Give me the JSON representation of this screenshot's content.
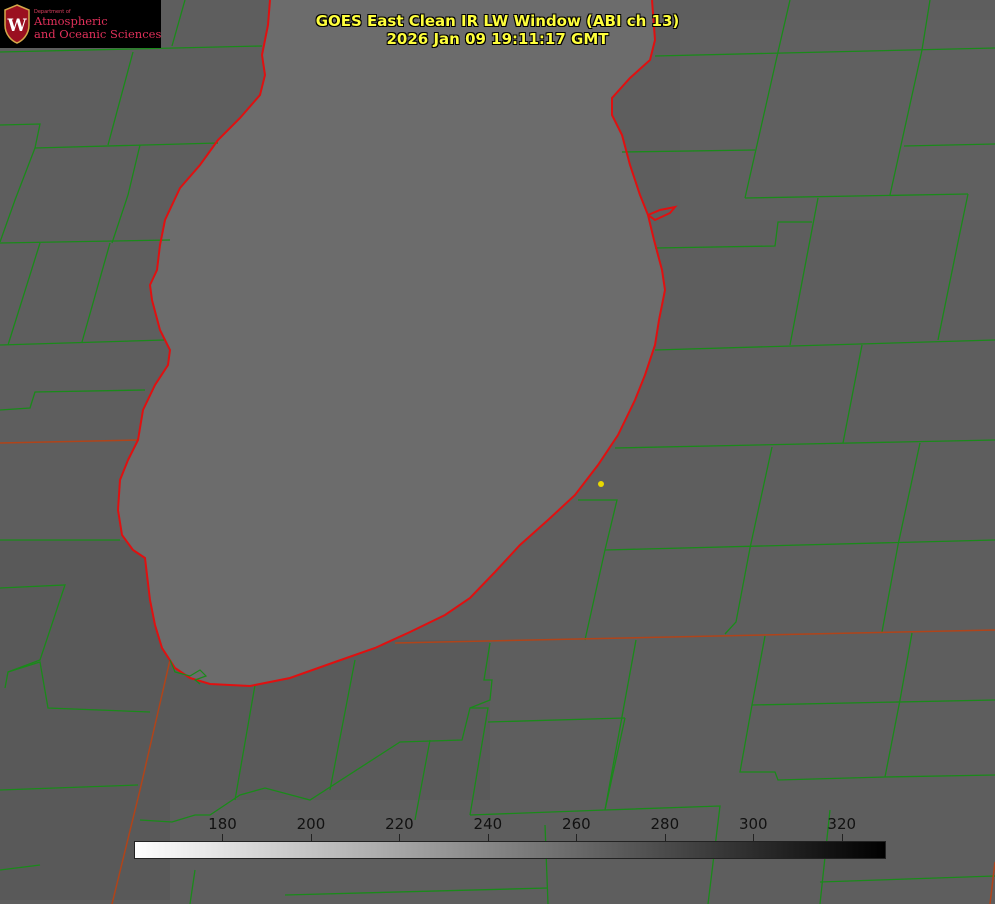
{
  "title": {
    "line1": "GOES East Clean IR LW Window (ABI ch 13)",
    "line2": "2026 Jan 09 19:11:17 GMT"
  },
  "logo": {
    "department": "Department of",
    "line1": "Atmospheric",
    "line2": "and Oceanic Sciences",
    "icon": "uw-crest-icon"
  },
  "colorbar": {
    "min": 160,
    "max": 330,
    "ticks": [
      180,
      200,
      220,
      240,
      260,
      280,
      300,
      320
    ],
    "gradient": [
      "#ffffff",
      "#000000"
    ]
  },
  "colors": {
    "land": "#5e5e5e",
    "lake": "#6c6c6c",
    "shoreline": "#e01010",
    "county_lines": "#1a8a1a",
    "state_lines": "#b0441a",
    "title_text": "#ffff3c",
    "marker": "#e8d800"
  },
  "icons": {
    "station_marker": "location-dot-icon"
  }
}
